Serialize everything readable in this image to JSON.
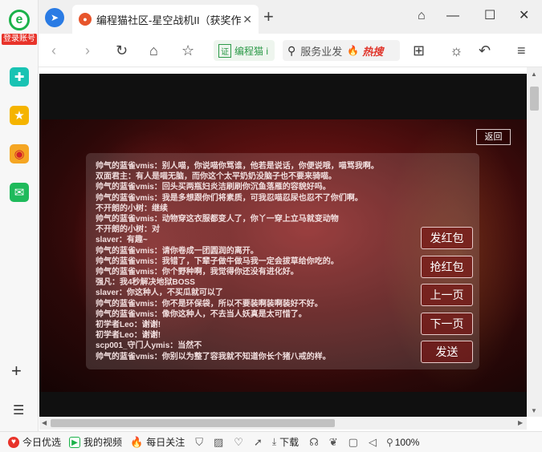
{
  "sidebar": {
    "login_label": "登录账号",
    "logo_letter": "e",
    "icons": [
      "plus-cross-icon",
      "star-icon",
      "weibo-icon",
      "mail-icon"
    ],
    "bottom": [
      "add-icon",
      "list-icon"
    ]
  },
  "tab": {
    "title": "编程猫社区-星空战机II（获奖作",
    "close": "✕"
  },
  "window": {
    "new_tab": "+",
    "shirt": "👕",
    "minimize": "—",
    "maximize": "☐",
    "close": "✕"
  },
  "toolbar": {
    "address_cert": "证",
    "address_text": "编程猫 i",
    "search_placeholder": "服务业发",
    "hot_label": "热搜"
  },
  "game": {
    "back_label": "返回",
    "chat": [
      "帅气的蓝雀vmis：别人喵，你说喵你骂谁，他若是说话，你便说哦，喵骂我啊。",
      "双面君主：有人是喵无脑，而你这个太平奶奶没脑子也不要来骑喵。",
      "帅气的蓝雀vmis：回头买两瓶妇炎洁刷刷你沉鱼落雁的容貌好吗。",
      "帅气的蓝雀vmis：我是多想跟你们将素质，可我忍喵忍尿也忍不了你们啊。",
      "不开朗的小树：继续",
      "帅气的蓝雀vmis：动物穿这衣服都变人了，你丫一穿上立马就变动物",
      "不开朗的小树：对",
      "slaver：有趣~",
      "帅气的蓝雀vmis：请你卷成一团圆润的离开。",
      "帅气的蓝雀vmis：我错了，下辈子做牛做马我一定会拔草给你吃的。",
      "帅气的蓝雀vmis：你个野种啊，我觉得你还没有进化好。",
      "强凡：我4秒解决地狱BOSS",
      "slaver：你这种人，不买瓜就可以了",
      "帅气的蓝雀vmis：你不是环保袋，所以不要装啊装啊装好不好。",
      "帅气的蓝雀vmis：像你这种人，不去当人妖真是太可惜了。",
      "初学者Leo：谢谢!",
      "初学者Leo：谢谢!",
      "scp001_守门人ymis：当然不",
      "帅气的蓝雀vmis：你别以为整了容我就不知道你长个猪八戒的样。"
    ],
    "buttons": {
      "red_packet_send": "发红包",
      "red_packet_grab": "抢红包",
      "prev_page": "上一页",
      "next_page": "下一页",
      "send": "发送"
    }
  },
  "statusbar": {
    "today": "今日优选",
    "video": "我的视频",
    "daily": "每日关注",
    "download": "下载",
    "zoom": "100%"
  }
}
